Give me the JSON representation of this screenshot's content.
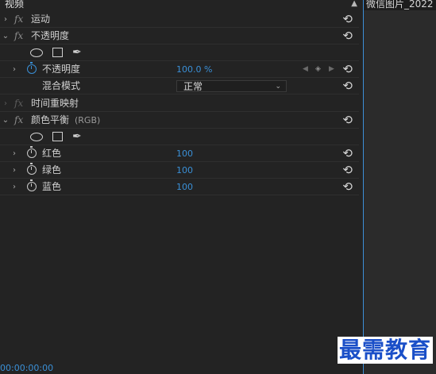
{
  "panel": {
    "section_title": "视频",
    "timecode": "00:00:00:00"
  },
  "timeline": {
    "clip_name": "微信图片_2022"
  },
  "effects": {
    "motion": {
      "label": "运动"
    },
    "opacity": {
      "label": "不透明度",
      "property_label": "不透明度",
      "property_value": "100.0 %",
      "blend_label": "混合模式",
      "blend_value": "正常"
    },
    "time_remap": {
      "label": "时间重映射"
    },
    "color_balance": {
      "label": "颜色平衡",
      "suffix": "(RGB)",
      "red_label": "红色",
      "red_value": "100",
      "green_label": "绿色",
      "green_value": "100",
      "blue_label": "蓝色",
      "blue_value": "100"
    }
  },
  "glyphs": {
    "fx": "fx",
    "reset": "⟲",
    "chev_right": "›",
    "chev_down": "⌄",
    "up": "▲",
    "pen": "✒",
    "kf_prev": "◀",
    "kf_add": "◈",
    "kf_next": "▶",
    "dd": "⌄"
  },
  "watermark": "最需教育",
  "colors": {
    "accent": "#3a8fd6",
    "panel_bg": "#232323",
    "watermark": "#1a4fc8"
  }
}
